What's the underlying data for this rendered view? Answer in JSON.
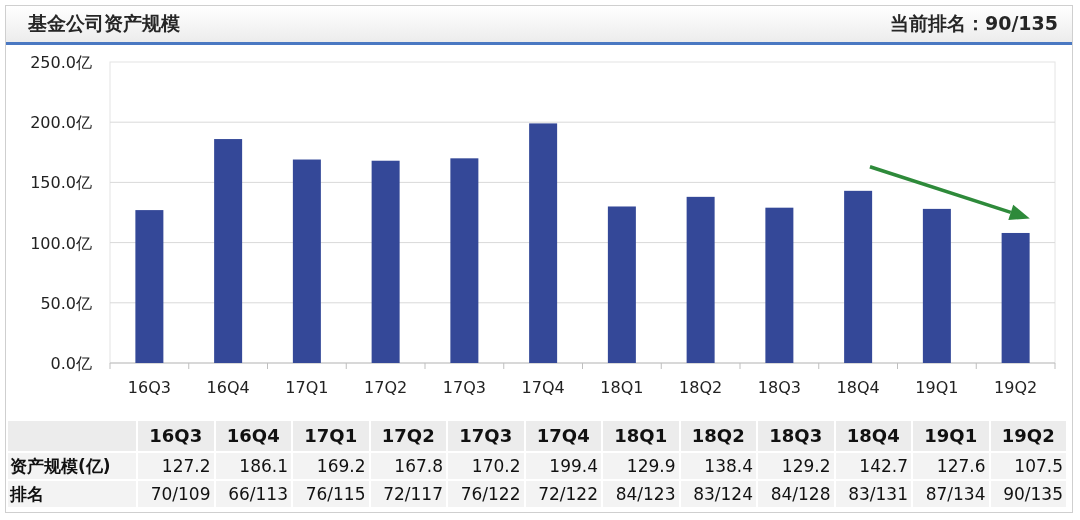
{
  "panel": {
    "title": "基金公司资产规模",
    "ranking": "当前排名：90/135"
  },
  "chart": {
    "chart_data": {
      "type": "bar",
      "categories": [
        "16Q3",
        "16Q4",
        "17Q1",
        "17Q2",
        "17Q3",
        "17Q4",
        "18Q1",
        "18Q2",
        "18Q3",
        "18Q4",
        "19Q1",
        "19Q2"
      ],
      "series": [
        {
          "color": "#344898",
          "values": [
            127,
            186,
            169,
            168,
            170,
            199,
            130,
            138,
            129,
            143,
            128,
            108
          ]
        }
      ],
      "grid": true,
      "ylim": [
        0,
        250
      ],
      "yticks": [
        {
          "value": 0,
          "label": "0.0亿"
        },
        {
          "value": 50,
          "label": "50.0亿"
        },
        {
          "value": 100,
          "label": "100.0亿"
        },
        {
          "value": 150,
          "label": "150.0亿"
        },
        {
          "value": 200,
          "label": "200.0亿"
        },
        {
          "value": 250,
          "label": "250.0亿"
        }
      ]
    }
  },
  "table": {
    "columns": [
      "16Q3",
      "16Q4",
      "17Q1",
      "17Q2",
      "17Q3",
      "17Q4",
      "18Q1",
      "18Q2",
      "18Q3",
      "18Q4",
      "19Q1",
      "19Q2"
    ],
    "rows": [
      {
        "label": "资产规模(亿)",
        "cells": [
          "127.2",
          "186.1",
          "169.2",
          "167.8",
          "170.2",
          "199.4",
          "129.9",
          "138.4",
          "129.2",
          "142.7",
          "127.6",
          "107.5"
        ]
      },
      {
        "label": "排名",
        "cells": [
          "70/109",
          "66/113",
          "76/115",
          "72/117",
          "76/122",
          "72/122",
          "84/123",
          "83/124",
          "84/128",
          "83/131",
          "87/134",
          "90/135"
        ]
      }
    ]
  }
}
